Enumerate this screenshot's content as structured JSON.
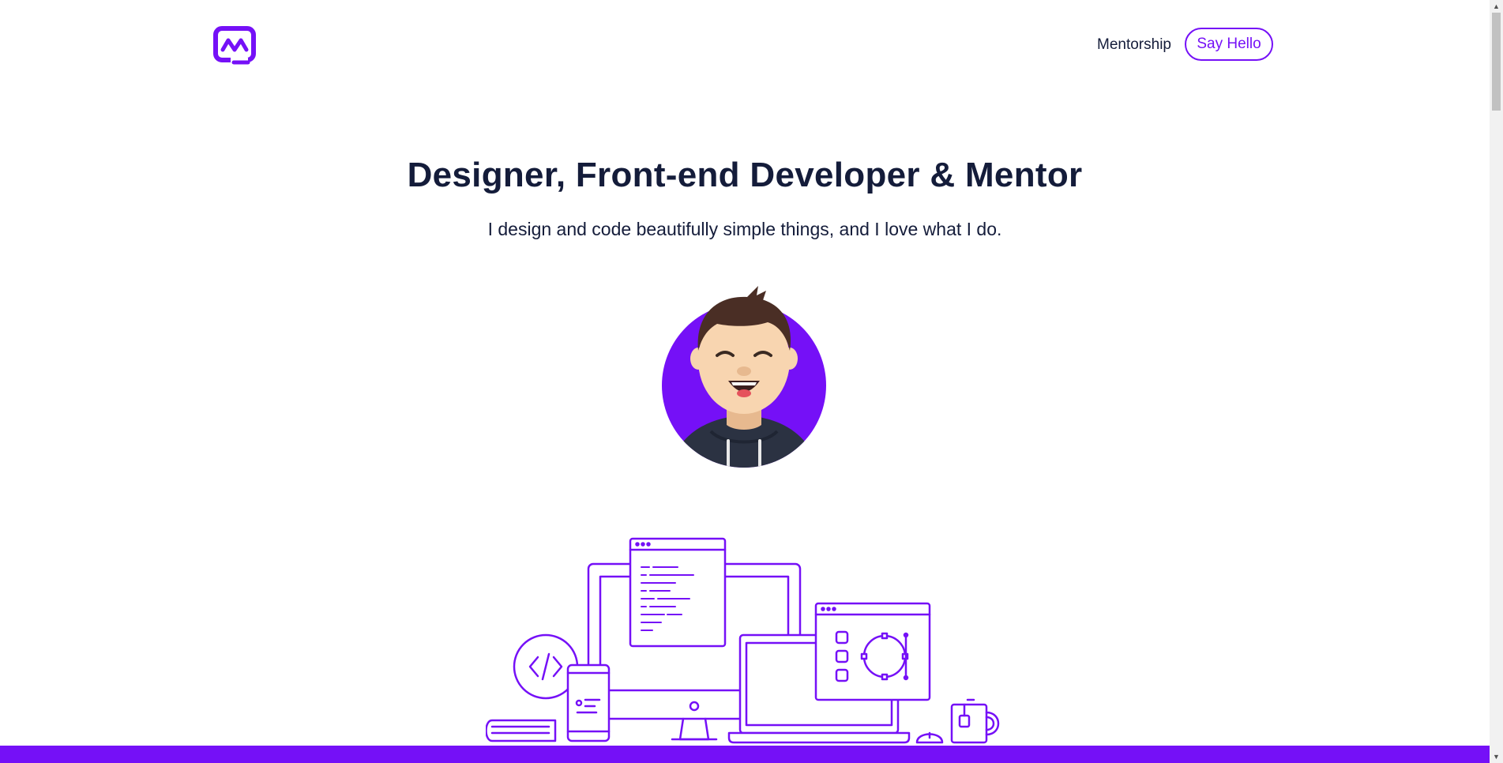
{
  "header": {
    "logo_icon": "brand-logo-icon",
    "nav": {
      "mentorship_label": "Mentorship",
      "say_hello_label": "Say Hello"
    }
  },
  "hero": {
    "title": "Designer, Front-end Developer & Mentor",
    "subtitle": "I design and code beautifully simple things, and I love what I do.",
    "avatar_icon": "avatar-illustration",
    "illustration_icon": "devices-illustration"
  },
  "colors": {
    "accent": "#7510f7",
    "text": "#141c3a",
    "skin": "#f8d5b0",
    "hair": "#4a2e25",
    "hoodie": "#2b3242"
  }
}
